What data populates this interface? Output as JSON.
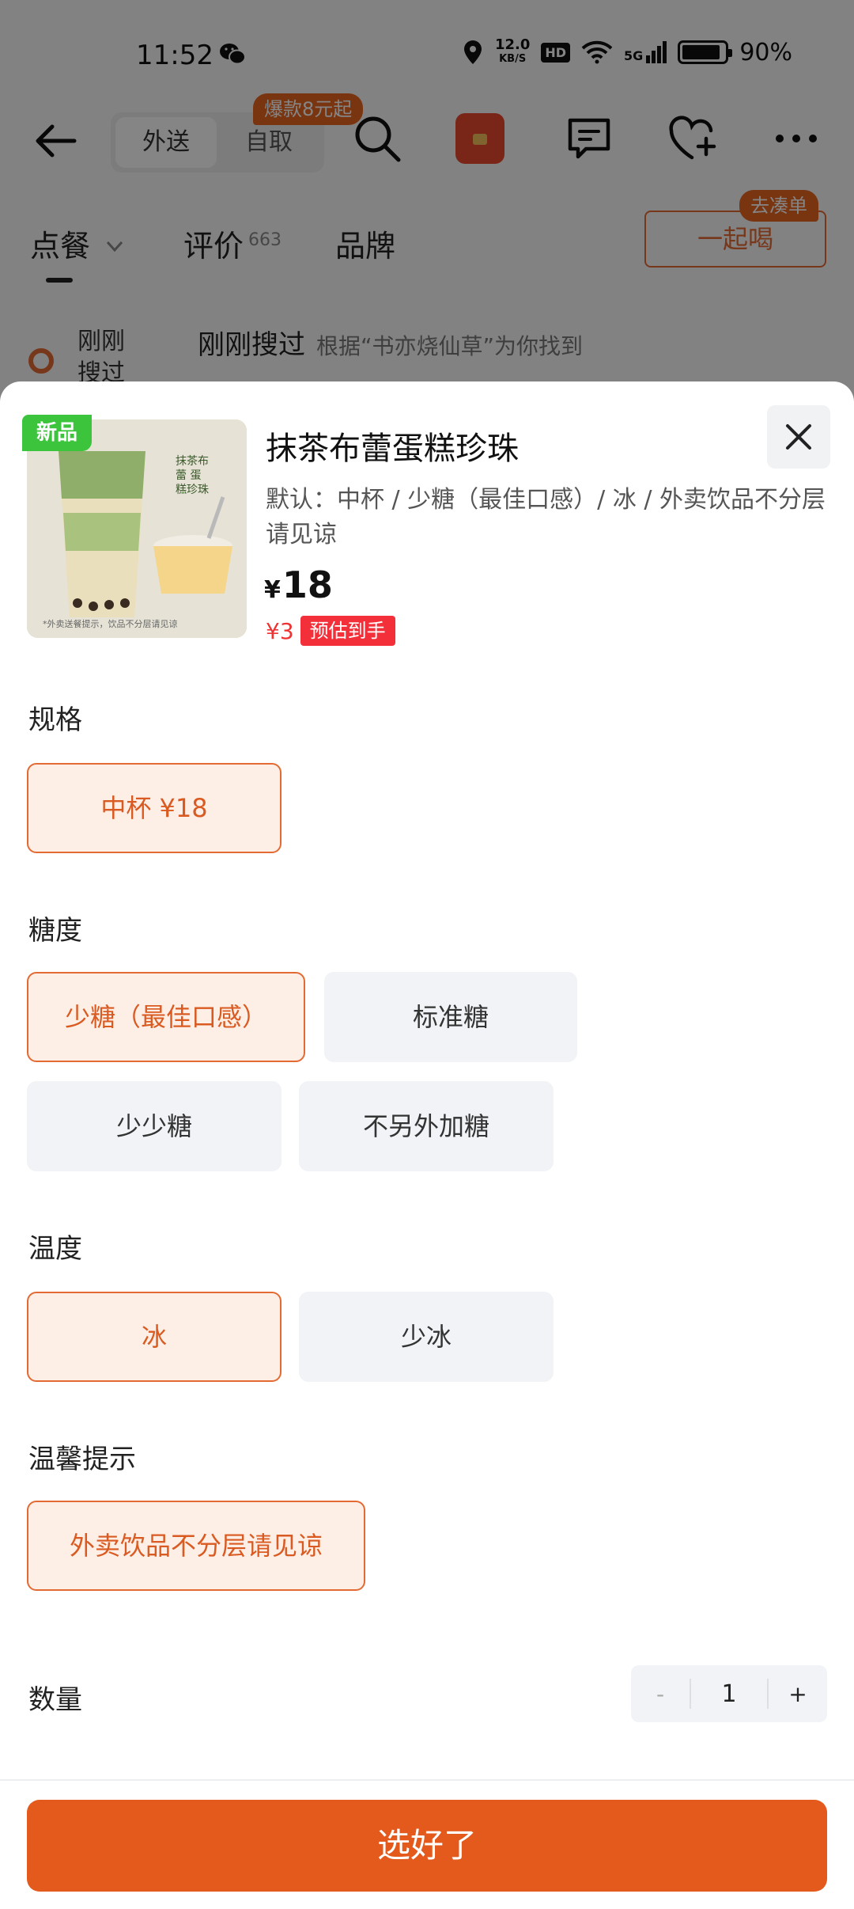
{
  "status_bar": {
    "time": "11:52",
    "speed_value": "12.0",
    "speed_unit": "KB/S",
    "hd": "HD",
    "network": "5G",
    "battery": "90%",
    "icons": [
      "wechat-icon",
      "location-icon",
      "wifi-icon",
      "signal-icon",
      "battery-icon"
    ]
  },
  "header": {
    "mode_delivery": "外送",
    "mode_pickup": "自取",
    "promo_badge": "爆款8元起",
    "icons": [
      "back-arrow-icon",
      "search-icon",
      "red-packet-icon",
      "message-icon",
      "heart-plus-icon",
      "more-icon"
    ]
  },
  "tabs": {
    "order": "点餐",
    "review": "评价",
    "review_count": "663",
    "brand": "品牌",
    "together_button": "一起喝",
    "together_badge": "去凑单"
  },
  "recent": {
    "side_label": "刚刚搜过",
    "title": "刚刚搜过",
    "hint": "根据“书亦烧仙草”为你找到"
  },
  "product": {
    "new_badge": "新品",
    "title": "抹茶布蕾蛋糕珍珠",
    "desc": "默认：中杯 / 少糖（最佳口感）/ 冰 / 外卖饮品不分层请见谅",
    "currency": "¥",
    "price": "18",
    "coupon_value": "¥3",
    "coupon_tag": "预估到手",
    "image_caption": "*外卖送餐提示，饮品不分层请见谅",
    "image_side_text": "抹茶布蕾 蛋糕珍珠"
  },
  "sections": {
    "size": {
      "title": "规格",
      "options": [
        "中杯 ¥18"
      ]
    },
    "sugar": {
      "title": "糖度",
      "options": [
        "少糖（最佳口感）",
        "标准糖",
        "少少糖",
        "不另外加糖"
      ]
    },
    "temp": {
      "title": "温度",
      "options": [
        "冰",
        "少冰"
      ]
    },
    "tips": {
      "title": "温馨提示",
      "options": [
        "外卖饮品不分层请见谅"
      ]
    }
  },
  "quantity": {
    "label": "数量",
    "minus": "-",
    "value": "1",
    "plus": "+"
  },
  "confirm_button": "选好了",
  "colors": {
    "accent": "#e4591c",
    "selected_bg": "#fdeee6",
    "selected_border": "#e46a33",
    "option_bg": "#f1f3f6",
    "new_badge": "#3cc43c",
    "coupon_red": "#f3303a"
  }
}
